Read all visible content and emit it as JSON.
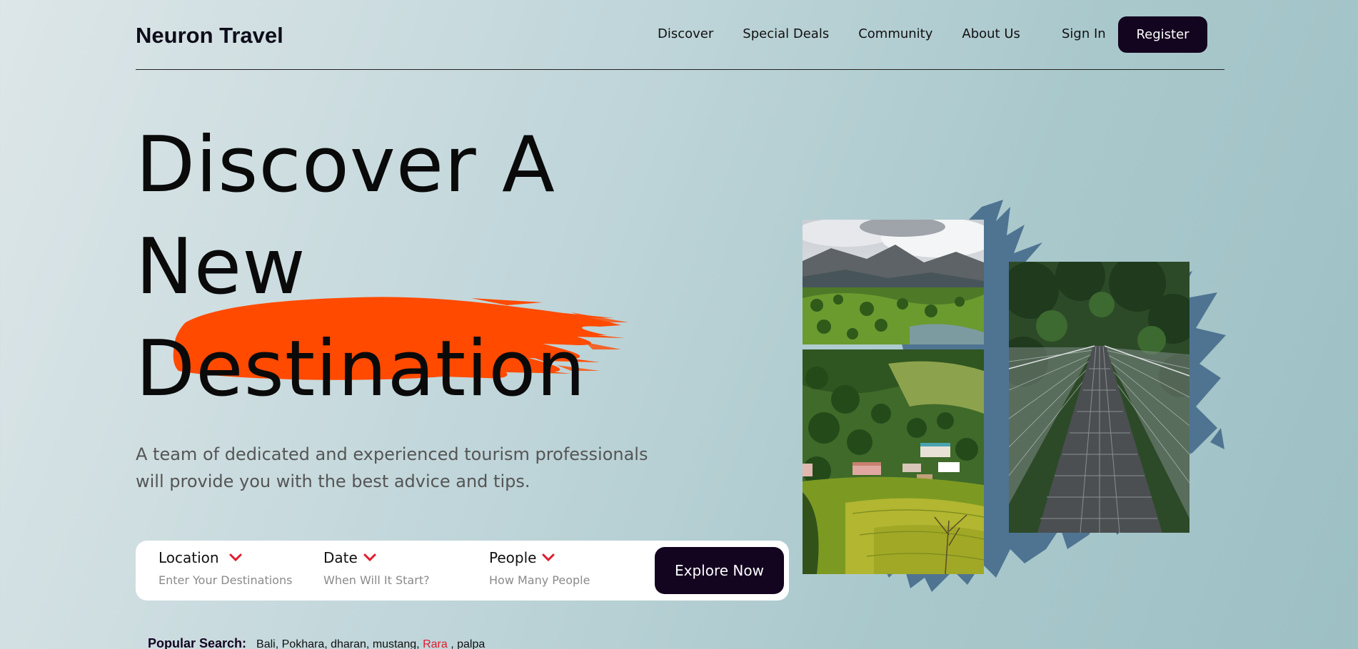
{
  "nav": {
    "logo": "Neuron Travel",
    "links": [
      "Discover",
      "Special Deals",
      "Community",
      "About Us"
    ],
    "sign_in": "Sign In",
    "register": "Register"
  },
  "hero": {
    "line1": "Discover A",
    "line2": "New",
    "line3": "Destination",
    "subtitle": "A team of dedicated and experienced tourism professionals will provide you with the best advice and tips."
  },
  "search": {
    "fields": [
      {
        "label": "Location",
        "placeholder": "Enter Your Destinations"
      },
      {
        "label": "Date",
        "placeholder": "When Will It Start?"
      },
      {
        "label": "People",
        "placeholder": "How Many People"
      }
    ],
    "button": "Explore Now"
  },
  "popular": {
    "label": "Popular Search:",
    "items_before": "Bali, Pokhara, dharan, mustang,",
    "highlight": "Rara",
    "items_after": ", palpa"
  },
  "colors": {
    "accent_dark": "#13041f",
    "brush_orange": "#ff4a00",
    "chevron_red": "#e01b2f",
    "paint_blue": "#4f7492"
  },
  "images": [
    "mountain-valley-photo",
    "hillside-village-photo",
    "suspension-bridge-photo"
  ]
}
